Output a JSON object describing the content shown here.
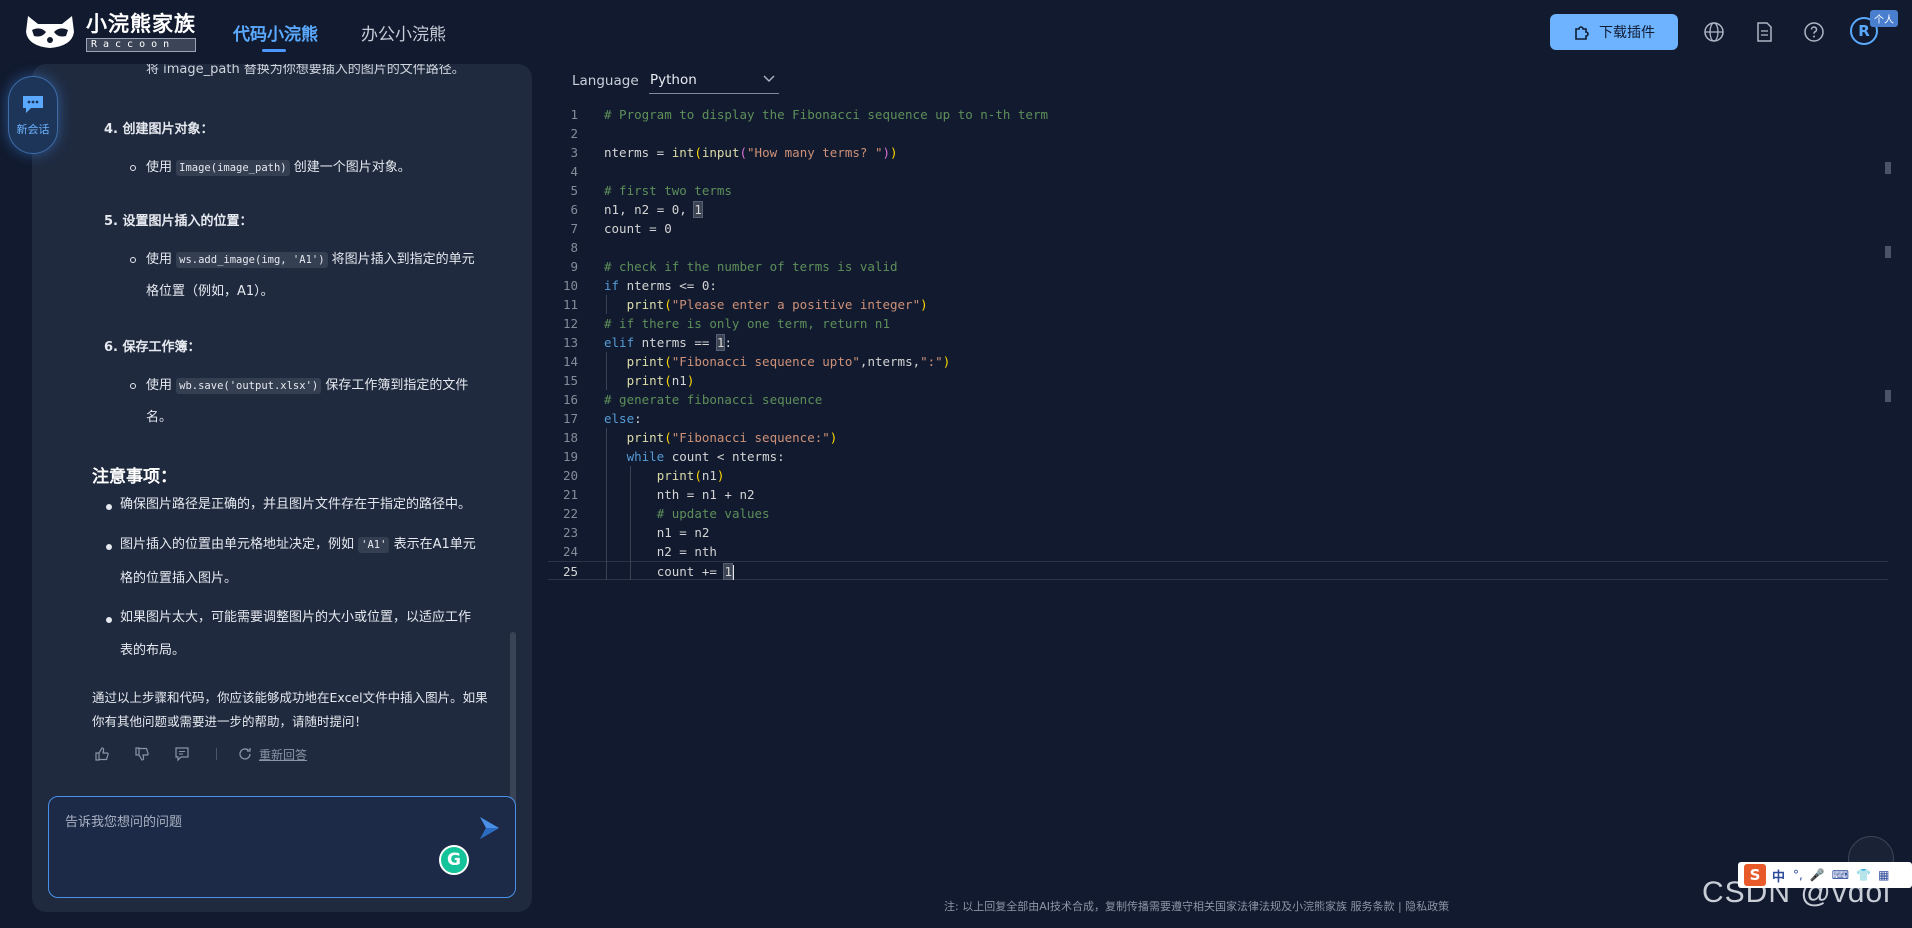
{
  "header": {
    "brand_cn": "小浣熊家族",
    "brand_en": "Raccoon",
    "tabs": [
      {
        "label": "代码小浣熊",
        "active": true
      },
      {
        "label": "办公小浣熊",
        "active": false
      }
    ],
    "download_label": "下载插件",
    "icons": [
      "globe-icon",
      "document-icon",
      "help-icon"
    ],
    "avatar_letter": "R",
    "avatar_badge": "个人",
    "accent": "#5aa9ff"
  },
  "chat": {
    "new_chat_label": "新会话",
    "top_fragment": "将 image_path 替换为你想要插入的图片的文件路径。",
    "steps": [
      {
        "title": "4. 创建图片对象：",
        "pre": "使用 ",
        "code": "Image(image_path)",
        "post": " 创建一个图片对象。",
        "post2": ""
      },
      {
        "title": "5. 设置图片插入的位置：",
        "pre": "使用 ",
        "code": "ws.add_image(img, 'A1')",
        "post": " 将图片插入到指定的单元",
        "post2": "格位置（例如，A1）。"
      },
      {
        "title": "6. 保存工作簿：",
        "pre": "使用 ",
        "code": "wb.save('output.xlsx')",
        "post": " 保存工作簿到指定的文件",
        "post2": "名。"
      }
    ],
    "notes_title": "注意事项：",
    "notes": [
      {
        "line1": "确保图片路径是正确的，并且图片文件存在于指定的路径中。",
        "line2": ""
      },
      {
        "pre": "图片插入的位置由单元格地址决定，例如 ",
        "code": "'A1'",
        "post": " 表示在A1单元",
        "line2": "格的位置插入图片。"
      },
      {
        "line1": "如果图片太大，可能需要调整图片的大小或位置，以适应工作",
        "line2": "表的布局。"
      }
    ],
    "summary": "通过以上步骤和代码，你应该能够成功地在Excel文件中插入图片。如果你有其他问题或需要进一步的帮助，请随时提问！",
    "regenerate_label": "重新回答",
    "input_placeholder": "告诉我您想问的问题",
    "input_value": ""
  },
  "editor": {
    "language_label": "Language",
    "language_value": "Python",
    "current_line": 25,
    "lines": [
      "# Program to display the Fibonacci sequence up to n-th term",
      "",
      "nterms = int(input(\"How many terms? \"))",
      "",
      "# first two terms",
      "n1, n2 = 0, 1",
      "count = 0",
      "",
      "# check if the number of terms is valid",
      "if nterms <= 0:",
      "   print(\"Please enter a positive integer\")",
      "# if there is only one term, return n1",
      "elif nterms == 1:",
      "   print(\"Fibonacci sequence upto\",nterms,\":\")",
      "   print(n1)",
      "# generate fibonacci sequence",
      "else:",
      "   print(\"Fibonacci sequence:\")",
      "   while count < nterms:",
      "       print(n1)",
      "       nth = n1 + n2",
      "       # update values",
      "       n1 = n2",
      "       n2 = nth",
      "       count += 1"
    ]
  },
  "footer": {
    "disclaimer": "注: 以上回复全部由AI技术合成，复制传播需要遵守相关国家法律法规及小浣熊家族 ",
    "terms_link": "服务条款",
    "separator": " | ",
    "privacy_link": "隐私政策"
  },
  "overlay": {
    "watermark": "CSDN @vdoi",
    "ime_label": "中"
  }
}
